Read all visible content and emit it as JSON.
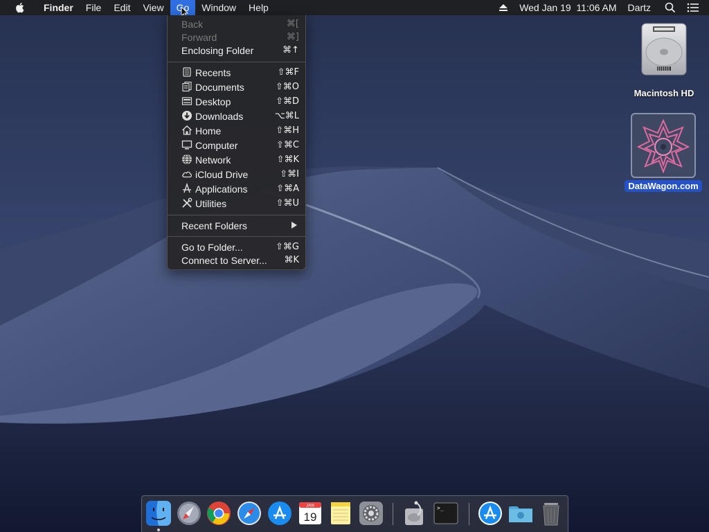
{
  "menubar": {
    "app_name": "Finder",
    "menus": [
      "File",
      "Edit",
      "View",
      "Go",
      "Window",
      "Help"
    ],
    "active_menu": "Go",
    "clock": "Wed Jan 19  11:06 AM",
    "user": "Dartz",
    "icons": [
      "apple-icon",
      "eject-icon",
      "spotlight-search-icon",
      "notification-center-icon"
    ]
  },
  "go_menu": {
    "items": [
      {
        "label": "Back",
        "shortcut": "⌘[",
        "enabled": false,
        "icon": ""
      },
      {
        "label": "Forward",
        "shortcut": "⌘]",
        "enabled": false,
        "icon": ""
      },
      {
        "label": "Enclosing Folder",
        "shortcut": "⌘↑",
        "enabled": true,
        "icon": ""
      },
      {
        "label": "Recents",
        "shortcut": "⇧⌘F",
        "enabled": true,
        "icon": "recents-icon"
      },
      {
        "label": "Documents",
        "shortcut": "⇧⌘O",
        "enabled": true,
        "icon": "documents-icon"
      },
      {
        "label": "Desktop",
        "shortcut": "⇧⌘D",
        "enabled": true,
        "icon": "desktop-icon"
      },
      {
        "label": "Downloads",
        "shortcut": "⌥⌘L",
        "enabled": true,
        "icon": "downloads-icon"
      },
      {
        "label": "Home",
        "shortcut": "⇧⌘H",
        "enabled": true,
        "icon": "home-icon"
      },
      {
        "label": "Computer",
        "shortcut": "⇧⌘C",
        "enabled": true,
        "icon": "computer-icon"
      },
      {
        "label": "Network",
        "shortcut": "⇧⌘K",
        "enabled": true,
        "icon": "network-icon"
      },
      {
        "label": "iCloud Drive",
        "shortcut": "⇧⌘I",
        "enabled": true,
        "icon": "icloud-icon"
      },
      {
        "label": "Applications",
        "shortcut": "⇧⌘A",
        "enabled": true,
        "icon": "applications-icon"
      },
      {
        "label": "Utilities",
        "shortcut": "⇧⌘U",
        "enabled": true,
        "icon": "utilities-icon"
      },
      {
        "label": "Recent Folders",
        "shortcut": "",
        "enabled": true,
        "icon": "",
        "submenu": true
      },
      {
        "label": "Go to Folder...",
        "shortcut": "⇧⌘G",
        "enabled": true,
        "icon": ""
      },
      {
        "label": "Connect to Server...",
        "shortcut": "⌘K",
        "enabled": true,
        "icon": ""
      }
    ]
  },
  "desktop": {
    "icons": [
      {
        "label": "Macintosh HD",
        "icon": "hard-drive-icon",
        "selected": false
      },
      {
        "label": "DataWagon.com",
        "icon": "datawagon-image-icon",
        "selected": true
      }
    ]
  },
  "dock": {
    "apps": [
      {
        "name": "finder-icon",
        "running": true
      },
      {
        "name": "launchpad-icon",
        "running": false
      },
      {
        "name": "chrome-icon",
        "running": false
      },
      {
        "name": "safari-icon",
        "running": false
      },
      {
        "name": "app-store-icon",
        "running": false
      },
      {
        "name": "calendar-icon",
        "running": false,
        "month": "JAN",
        "day": "19"
      },
      {
        "name": "notes-icon",
        "running": false
      },
      {
        "name": "system-preferences-icon",
        "running": false
      },
      {
        "name": "disk-utility-icon",
        "running": false
      },
      {
        "name": "terminal-icon",
        "running": false
      },
      {
        "name": "applications-folder-icon",
        "running": false
      },
      {
        "name": "downloads-folder-icon",
        "running": false
      },
      {
        "name": "trash-icon",
        "running": false
      }
    ]
  },
  "colors": {
    "menu_highlight": "#2f6fe0",
    "selection_label": "#2553c7",
    "menu_bg": "#26262a"
  }
}
